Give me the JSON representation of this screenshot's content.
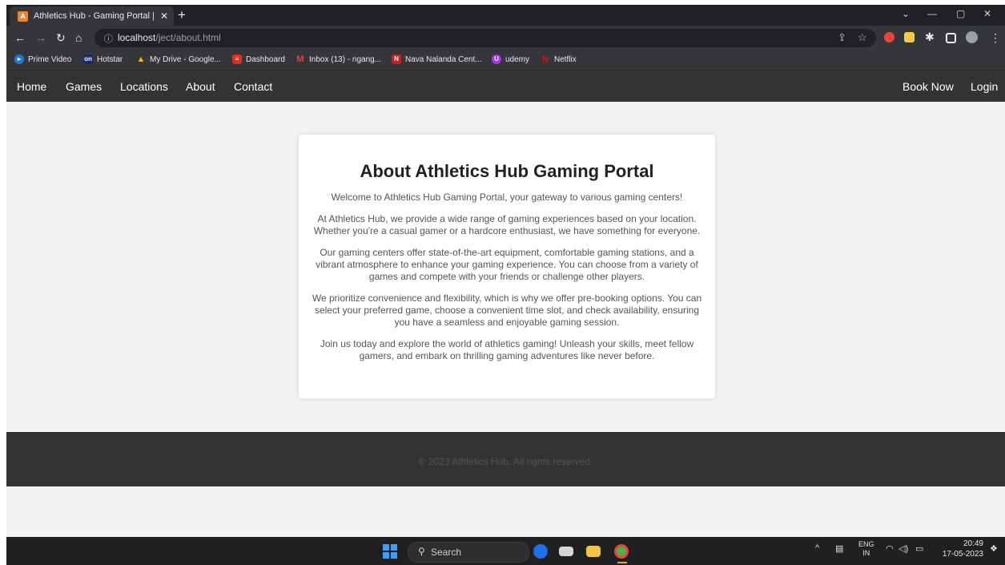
{
  "browser": {
    "tab_title": "Athletics Hub - Gaming Portal | A",
    "tab_favicon": "A",
    "url_host": "localhost",
    "url_path": "/ject/about.html",
    "bookmarks": [
      {
        "label": "Prime Video",
        "icon": "prime-video-icon",
        "color": "#1f7ad2",
        "glyph": "▸"
      },
      {
        "label": "Hotstar",
        "icon": "hotstar-icon",
        "color": "#1a2a6c",
        "glyph": "on"
      },
      {
        "label": "My Drive - Google...",
        "icon": "google-drive-icon",
        "color": "#f4b400",
        "glyph": "▲"
      },
      {
        "label": "Dashboard",
        "icon": "dashboard-icon",
        "color": "#d93025",
        "glyph": "≡"
      },
      {
        "label": "Inbox (13) - ngang...",
        "icon": "gmail-icon",
        "color": "#ea4335",
        "glyph": "M"
      },
      {
        "label": "Nava Nalanda Cent...",
        "icon": "nava-nalanda-icon",
        "color": "#c5221f",
        "glyph": "N"
      },
      {
        "label": "udemy",
        "icon": "udemy-icon",
        "color": "#a435f0",
        "glyph": "U"
      },
      {
        "label": "Netflix",
        "icon": "netflix-icon",
        "color": "#e50914",
        "glyph": "N"
      }
    ]
  },
  "site": {
    "nav_left": [
      "Home",
      "Games",
      "Locations",
      "About",
      "Contact"
    ],
    "nav_right": [
      "Book Now",
      "Login"
    ],
    "heading": "About Athletics Hub Gaming Portal",
    "paragraphs": [
      "Welcome to Athletics Hub Gaming Portal, your gateway to various gaming centers!",
      "At Athletics Hub, we provide a wide range of gaming experiences based on your location. Whether you're a casual gamer or a hardcore enthusiast, we have something for everyone.",
      "Our gaming centers offer state-of-the-art equipment, comfortable gaming stations, and a vibrant atmosphere to enhance your gaming experience. You can choose from a variety of games and compete with your friends or challenge other players.",
      "We prioritize convenience and flexibility, which is why we offer pre-booking options. You can select your preferred game, choose a convenient time slot, and check availability, ensuring you have a seamless and enjoyable gaming session.",
      "Join us today and explore the world of athletics gaming! Unleash your skills, meet fellow gamers, and embark on thrilling gaming adventures like never before."
    ],
    "footer": "© 2023 Athletics Hub. All rights reserved."
  },
  "taskbar": {
    "search_label": "Search",
    "lang_top": "ENG",
    "lang_bottom": "IN",
    "time": "20:49",
    "date": "17-05-2023"
  },
  "colors": {
    "navbar_bg": "#333333",
    "page_bg": "#f2f2f2",
    "card_bg": "#ffffff",
    "footer_bg": "#333333"
  }
}
